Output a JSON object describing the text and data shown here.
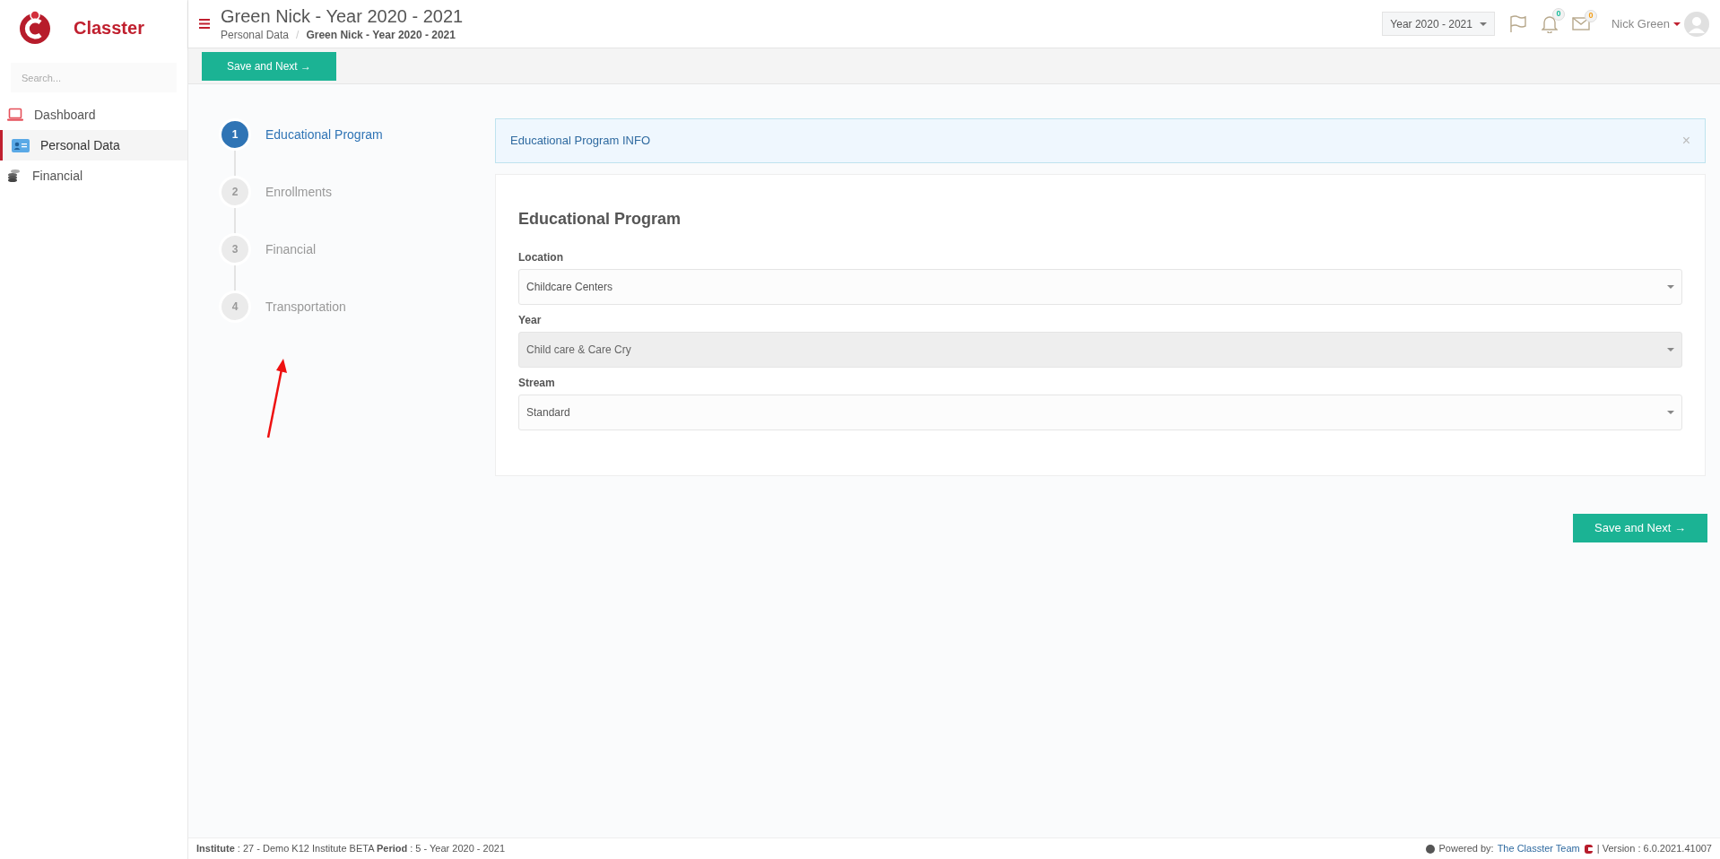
{
  "brand": {
    "name": "Classter"
  },
  "sidebar": {
    "search": {
      "placeholder": "Search..."
    },
    "items": [
      {
        "label": "Dashboard",
        "kind": "laptop",
        "selected": false
      },
      {
        "label": "Personal Data",
        "kind": "card",
        "selected": true
      },
      {
        "label": "Financial",
        "kind": "coins",
        "selected": false
      }
    ]
  },
  "header": {
    "title": "Green Nick - Year 2020 - 2021",
    "breadcrumb": [
      "Personal Data",
      "Green Nick - Year 2020 - 2021"
    ],
    "breadcrumb_separator": "/",
    "year_select": "Year 2020 - 2021",
    "badges": [
      {
        "kind": "bell",
        "count": "0",
        "color": "#1abc9c"
      },
      {
        "kind": "mail",
        "count": "0",
        "color": "#f39c12"
      }
    ],
    "user": "Nick Green"
  },
  "toolbar": {
    "button": "Save and Next →"
  },
  "steps": [
    {
      "number": "1",
      "label": "Educational Program",
      "selected": true
    },
    {
      "number": "2",
      "label": "Enrollments",
      "selected": false
    },
    {
      "number": "3",
      "label": "Financial",
      "selected": false
    },
    {
      "number": "4",
      "label": "Transportation",
      "selected": false
    }
  ],
  "info": {
    "text": "Educational Program INFO",
    "close": "×"
  },
  "form": {
    "title": "Educational Program",
    "fields": [
      {
        "label": "Location",
        "value": "Childcare Centers",
        "disabled": false
      },
      {
        "label": "Year",
        "value": "Child care & Care Cry",
        "disabled": true
      },
      {
        "label": "Stream",
        "value": "Standard",
        "disabled": false
      }
    ]
  },
  "bottom_button": "Save and Next →",
  "footer": {
    "left": "**Institute** : 27 - Demo K12 Institute BETA **Period** : 5 - Year 2020 - 2021",
    "powered": "Powered by:",
    "link": "The Classter Team",
    "version": "| Version : 6.0.2021.41007"
  }
}
